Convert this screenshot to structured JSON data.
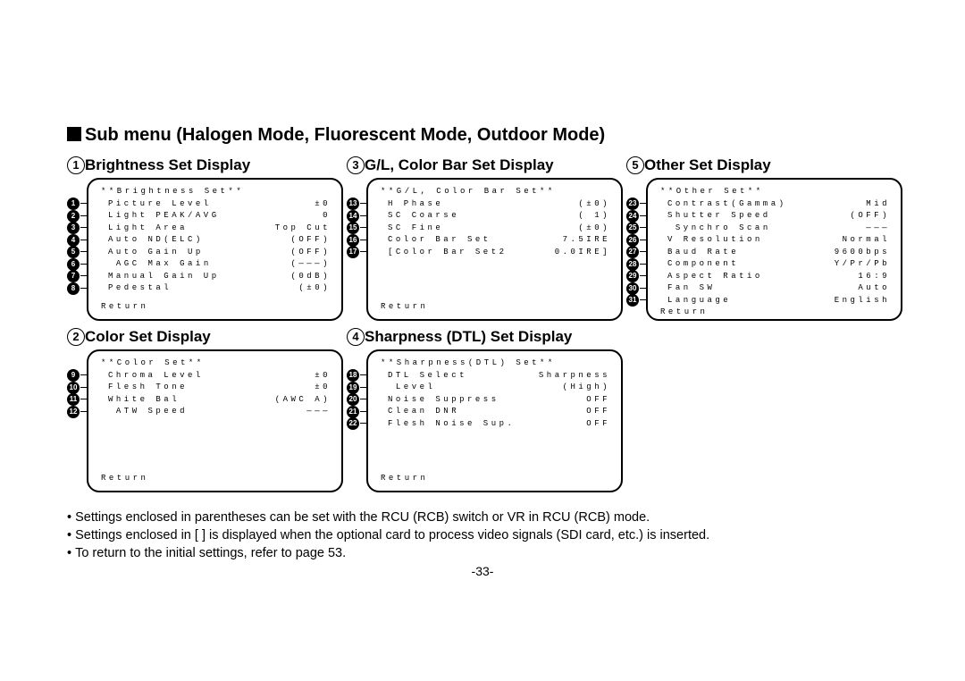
{
  "heading": "Sub menu (Halogen Mode, Fluorescent Mode, Outdoor Mode)",
  "sections": {
    "s1": {
      "num": "1",
      "title": "Brightness Set Display",
      "panel_title": "**Brightness Set**",
      "return": "Return",
      "items": [
        {
          "b": "1",
          "label": "Picture Level",
          "value": "±0",
          "indent": false
        },
        {
          "b": "2",
          "label": "Light PEAK/AVG",
          "value": "0",
          "indent": false
        },
        {
          "b": "3",
          "label": "Light Area",
          "value": "Top Cut",
          "indent": false
        },
        {
          "b": "4",
          "label": "Auto ND(ELC)",
          "value": "(OFF)",
          "indent": false
        },
        {
          "b": "5",
          "label": "Auto Gain Up",
          "value": "(OFF)",
          "indent": false
        },
        {
          "b": "6",
          "label": "AGC Max Gain",
          "value": "(———)",
          "indent": true
        },
        {
          "b": "7",
          "label": "Manual Gain Up",
          "value": "(0dB)",
          "indent": false
        },
        {
          "b": "8",
          "label": "Pedestal",
          "value": "(±0)",
          "indent": false
        }
      ]
    },
    "s2": {
      "num": "2",
      "title": "Color Set Display",
      "panel_title": "**Color Set**",
      "return": "Return",
      "items": [
        {
          "b": "9",
          "label": "Chroma Level",
          "value": "±0",
          "indent": false
        },
        {
          "b": "10",
          "label": "Flesh Tone",
          "value": "±0",
          "indent": false
        },
        {
          "b": "11",
          "label": "White Bal",
          "value": "(AWC A)",
          "indent": false
        },
        {
          "b": "12",
          "label": "ATW Speed",
          "value": "———",
          "indent": true
        }
      ]
    },
    "s3": {
      "num": "3",
      "title": "G/L, Color Bar Set Display",
      "panel_title": "**G/L, Color Bar Set**",
      "return": "Return",
      "items": [
        {
          "b": "13",
          "label": "H Phase",
          "value": "(±0)",
          "indent": false
        },
        {
          "b": "14",
          "label": "SC Coarse",
          "value": "( 1)",
          "indent": false
        },
        {
          "b": "15",
          "label": "SC Fine",
          "value": "(±0)",
          "indent": false
        },
        {
          "b": "16",
          "label": "Color Bar Set",
          "value": "7.5IRE",
          "indent": false
        },
        {
          "b": "17",
          "label": "[Color Bar Set2",
          "value": "0.0IRE]",
          "indent": false
        }
      ]
    },
    "s4": {
      "num": "4",
      "title": "Sharpness (DTL) Set Display",
      "panel_title": "**Sharpness(DTL) Set**",
      "return": "Return",
      "items": [
        {
          "b": "18",
          "label": "DTL Select",
          "value": "Sharpness",
          "indent": false
        },
        {
          "b": "19",
          "label": "Level",
          "value": "(High)",
          "indent": true
        },
        {
          "b": "20",
          "label": "Noise Suppress",
          "value": "OFF",
          "indent": false
        },
        {
          "b": "21",
          "label": "Clean DNR",
          "value": "OFF",
          "indent": false
        },
        {
          "b": "22",
          "label": "Flesh Noise Sup.",
          "value": "OFF",
          "indent": false
        }
      ]
    },
    "s5": {
      "num": "5",
      "title": "Other Set Display",
      "panel_title": "**Other Set**",
      "return": "Return",
      "items": [
        {
          "b": "23",
          "label": "Contrast(Gamma)",
          "value": "Mid",
          "indent": false
        },
        {
          "b": "24",
          "label": "Shutter Speed",
          "value": "(OFF)",
          "indent": false
        },
        {
          "b": "25",
          "label": "Synchro Scan",
          "value": "———",
          "indent": true
        },
        {
          "b": "26",
          "label": "V Resolution",
          "value": "Normal",
          "indent": false
        },
        {
          "b": "27",
          "label": "Baud Rate",
          "value": "9600bps",
          "indent": false
        },
        {
          "b": "28",
          "label": "Component",
          "value": "Y/Pr/Pb",
          "indent": false
        },
        {
          "b": "29",
          "label": "Aspect Ratio",
          "value": "16:9",
          "indent": false
        },
        {
          "b": "30",
          "label": "Fan SW",
          "value": "Auto",
          "indent": false
        },
        {
          "b": "31",
          "label": "Language",
          "value": "English",
          "indent": false
        }
      ]
    }
  },
  "notes": [
    "Settings enclosed in parentheses can be set with the RCU (RCB) switch or VR in RCU (RCB) mode.",
    "Settings enclosed in [  ] is displayed when the optional card to process video signals (SDI card, etc.) is inserted.",
    "To return to the initial settings, refer to page 53."
  ],
  "page_number": "-33-"
}
